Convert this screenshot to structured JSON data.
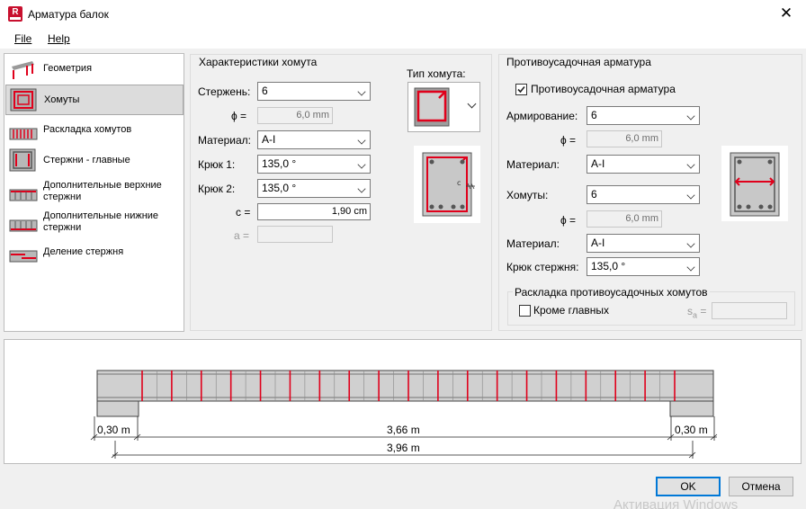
{
  "window": {
    "title": "Арматура балок",
    "close_glyph": "✕"
  },
  "menu": {
    "file": "File",
    "help": "Help"
  },
  "nav": {
    "items": [
      {
        "label": "Геометрия",
        "icon": "geometry-icon"
      },
      {
        "label": "Хомуты",
        "icon": "stirrups-icon",
        "selected": true
      },
      {
        "label": "Раскладка хомутов",
        "icon": "stirrup-layout-icon"
      },
      {
        "label": "Стержни - главные",
        "icon": "main-bars-icon"
      },
      {
        "label": "Дополнительные верхние стержни",
        "icon": "extra-top-bars-icon"
      },
      {
        "label": "Дополнительные нижние стержни",
        "icon": "extra-bottom-bars-icon"
      },
      {
        "label": "Деление стержня",
        "icon": "bar-split-icon"
      }
    ]
  },
  "stirrup": {
    "group_title": "Характеристики хомута",
    "bar_label": "Стержень:",
    "bar_value": "6",
    "phi_label": "ϕ =",
    "phi_value": "6,0 mm",
    "material_label": "Материал:",
    "material_value": "A-I",
    "hook1_label": "Крюк 1:",
    "hook1_value": "135,0 °",
    "hook2_label": "Крюк 2:",
    "hook2_value": "135,0 °",
    "c_label": "c =",
    "c_value": "1,90 cm",
    "a_label": "a =",
    "a_value": "",
    "type_label": "Тип хомута:"
  },
  "shrink": {
    "group_title": "Противоусадочная арматура",
    "checkbox_label": "Противоусадочная арматура",
    "checkbox_checked": true,
    "reinf_label": "Армирование:",
    "reinf_value": "6",
    "phi1_label": "ϕ =",
    "phi1_value": "6,0 mm",
    "material1_label": "Материал:",
    "material1_value": "A-I",
    "stirrups_label": "Хомуты:",
    "stirrups_value": "6",
    "phi2_label": "ϕ =",
    "phi2_value": "6,0 mm",
    "material2_label": "Материал:",
    "material2_value": "A-I",
    "hook_label": "Крюк стержня:",
    "hook_value": "135,0 °",
    "layout_title": "Раскладка противоусадочных хомутов",
    "except_main_label": "Кроме главных",
    "except_main_checked": false,
    "sa_label": "s",
    "sa_sub": "a",
    "sa_eq": " =",
    "sa_value": ""
  },
  "beam": {
    "left_support": "0,30 m",
    "span": "3,66 m",
    "right_support": "0,30 m",
    "total": "3,96 m",
    "stirrup_count": 19
  },
  "buttons": {
    "ok": "OK",
    "cancel": "Отмена"
  },
  "watermark": "Активация Windows",
  "colors": {
    "accent": "#0078d7",
    "rebar": "#e0001b",
    "concrete": "#d0d0d0"
  }
}
